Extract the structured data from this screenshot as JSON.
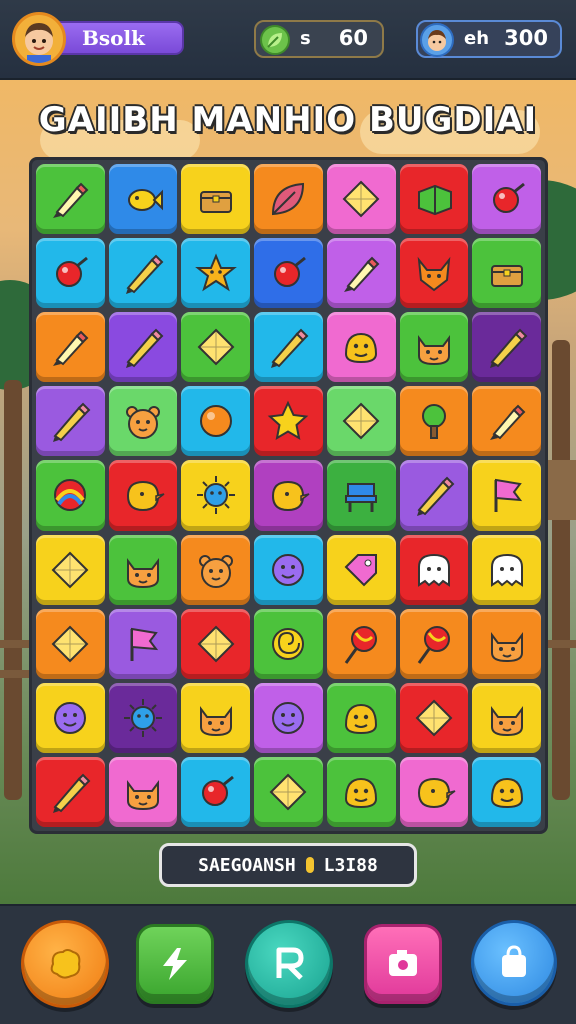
{
  "header": {
    "player_name": "Bsolk",
    "leaf_label": "s",
    "leaf_value": "60",
    "friend_label": "eh",
    "friend_value": "300"
  },
  "title": "GAIIBH MANHIO BUGDIAI",
  "score": {
    "label": "SAEGOANSH",
    "value": "L3I88"
  },
  "colors": {
    "green": "#4cc23c",
    "blue": "#2f8ae8",
    "yellow": "#f7d21c",
    "orange": "#f58a1e",
    "pink": "#f06ad0",
    "red": "#e8262a",
    "purple": "#9a5ae0",
    "cyan": "#22b8ea",
    "teal": "#3cc7a6",
    "magenta": "#d23aa8",
    "dark-purple": "#6a2a9a",
    "lightgreen": "#6ad86a"
  },
  "board": {
    "rows": [
      [
        {
          "color": "#4cc23c",
          "icon": "crayon-icon"
        },
        {
          "color": "#2f8ae8",
          "icon": "fish-icon"
        },
        {
          "color": "#f7d21c",
          "icon": "chest-icon"
        },
        {
          "color": "#f58a1e",
          "icon": "leaf-icon"
        },
        {
          "color": "#f06ad0",
          "icon": "gem-icon"
        },
        {
          "color": "#e8262a",
          "icon": "book-icon"
        },
        {
          "color": "#c060e8",
          "icon": "ball-icon"
        }
      ],
      [
        {
          "color": "#22b8ea",
          "icon": "ball-icon"
        },
        {
          "color": "#22b8ea",
          "icon": "pencil-icon"
        },
        {
          "color": "#22b8ea",
          "icon": "star-face-icon"
        },
        {
          "color": "#2f6ee8",
          "icon": "ball-icon"
        },
        {
          "color": "#c060e8",
          "icon": "crayon-icon"
        },
        {
          "color": "#e8262a",
          "icon": "fox-icon"
        },
        {
          "color": "#4cc23c",
          "icon": "chest-icon"
        }
      ],
      [
        {
          "color": "#f58a1e",
          "icon": "crayon-icon"
        },
        {
          "color": "#8a4ae0",
          "icon": "pencil-icon"
        },
        {
          "color": "#4cc23c",
          "icon": "gem-icon"
        },
        {
          "color": "#22b8ea",
          "icon": "pencil-icon"
        },
        {
          "color": "#f06ad0",
          "icon": "monster-icon"
        },
        {
          "color": "#4cc23c",
          "icon": "cat-face-icon"
        },
        {
          "color": "#6a2a9a",
          "icon": "pencil-icon"
        }
      ],
      [
        {
          "color": "#9a5ae0",
          "icon": "pencil-icon"
        },
        {
          "color": "#6ad86a",
          "icon": "bear-face-icon"
        },
        {
          "color": "#22b8ea",
          "icon": "orange-ball-icon"
        },
        {
          "color": "#e8262a",
          "icon": "star-icon"
        },
        {
          "color": "#6ad86a",
          "icon": "gem-icon"
        },
        {
          "color": "#f58a1e",
          "icon": "tree-icon"
        },
        {
          "color": "#f58a1e",
          "icon": "crayon-icon"
        }
      ],
      [
        {
          "color": "#4cc23c",
          "icon": "rainbow-ball-icon"
        },
        {
          "color": "#e8262a",
          "icon": "bird-face-icon"
        },
        {
          "color": "#f7d21c",
          "icon": "sun-face-icon"
        },
        {
          "color": "#b040c0",
          "icon": "bird-face-icon"
        },
        {
          "color": "#3cb040",
          "icon": "chair-icon"
        },
        {
          "color": "#9a5ae0",
          "icon": "pencil-icon"
        },
        {
          "color": "#f7d21c",
          "icon": "flag-icon"
        }
      ],
      [
        {
          "color": "#f7d21c",
          "icon": "gem-icon"
        },
        {
          "color": "#4cc23c",
          "icon": "cat-face-icon"
        },
        {
          "color": "#f58a1e",
          "icon": "bear-face-icon"
        },
        {
          "color": "#22b8ea",
          "icon": "smile-face-icon"
        },
        {
          "color": "#f7d21c",
          "icon": "tag-icon"
        },
        {
          "color": "#e8262a",
          "icon": "ghost-icon"
        },
        {
          "color": "#f7d21c",
          "icon": "ghost-icon"
        }
      ],
      [
        {
          "color": "#f58a1e",
          "icon": "gem-icon"
        },
        {
          "color": "#9a5ae0",
          "icon": "flag-icon"
        },
        {
          "color": "#e8262a",
          "icon": "gem-icon"
        },
        {
          "color": "#4cc23c",
          "icon": "swirl-icon"
        },
        {
          "color": "#f58a1e",
          "icon": "lollipop-icon"
        },
        {
          "color": "#f58a1e",
          "icon": "lollipop-icon"
        },
        {
          "color": "#f58a1e",
          "icon": "cat-face-icon"
        }
      ],
      [
        {
          "color": "#f7d21c",
          "icon": "smile-face-icon"
        },
        {
          "color": "#6a2a9a",
          "icon": "sun-face-icon"
        },
        {
          "color": "#f7d21c",
          "icon": "cat-face-icon"
        },
        {
          "color": "#c060e8",
          "icon": "smile-face-icon"
        },
        {
          "color": "#4cc23c",
          "icon": "monster-icon"
        },
        {
          "color": "#e8262a",
          "icon": "gem-icon"
        },
        {
          "color": "#f7d21c",
          "icon": "cat-face-icon"
        }
      ],
      [
        {
          "color": "#e8262a",
          "icon": "pencil-icon"
        },
        {
          "color": "#f06ad0",
          "icon": "cat-face-icon"
        },
        {
          "color": "#22b8ea",
          "icon": "ball-icon"
        },
        {
          "color": "#4cc23c",
          "icon": "gem-icon"
        },
        {
          "color": "#4cc23c",
          "icon": "monster-icon"
        },
        {
          "color": "#f06ad0",
          "icon": "bird-face-icon"
        },
        {
          "color": "#22b8ea",
          "icon": "monster-icon"
        }
      ]
    ]
  },
  "dock": {
    "buttons": [
      {
        "name": "orange-blob-button",
        "icon": "blob-icon"
      },
      {
        "name": "green-lightning-button",
        "icon": "lightning-icon"
      },
      {
        "name": "teal-r-button",
        "icon": "r-letter-icon"
      },
      {
        "name": "pink-photo-button",
        "icon": "photo-icon"
      },
      {
        "name": "blue-bag-button",
        "icon": "bag-icon"
      }
    ]
  }
}
